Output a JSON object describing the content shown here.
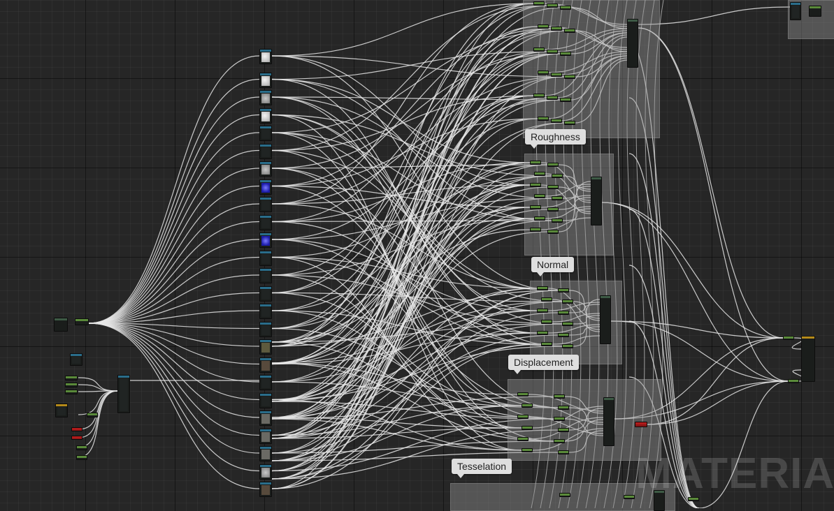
{
  "comments": [
    {
      "label": "",
      "name": "comment-base-color"
    },
    {
      "label": "Roughness",
      "name": "comment-roughness"
    },
    {
      "label": "Normal",
      "name": "comment-normal"
    },
    {
      "label": "Displacement",
      "name": "comment-displacement"
    },
    {
      "label": "Tesselation",
      "name": "comment-tesselation"
    }
  ],
  "watermark": "MATERIAL",
  "colors": {
    "wire": "#e8e8e8",
    "graph_bg": "#262626",
    "node_green": "#5a8a3a",
    "node_blue": "#2a6d8a",
    "node_red": "#b01b1b",
    "node_gold": "#b58a1a"
  }
}
